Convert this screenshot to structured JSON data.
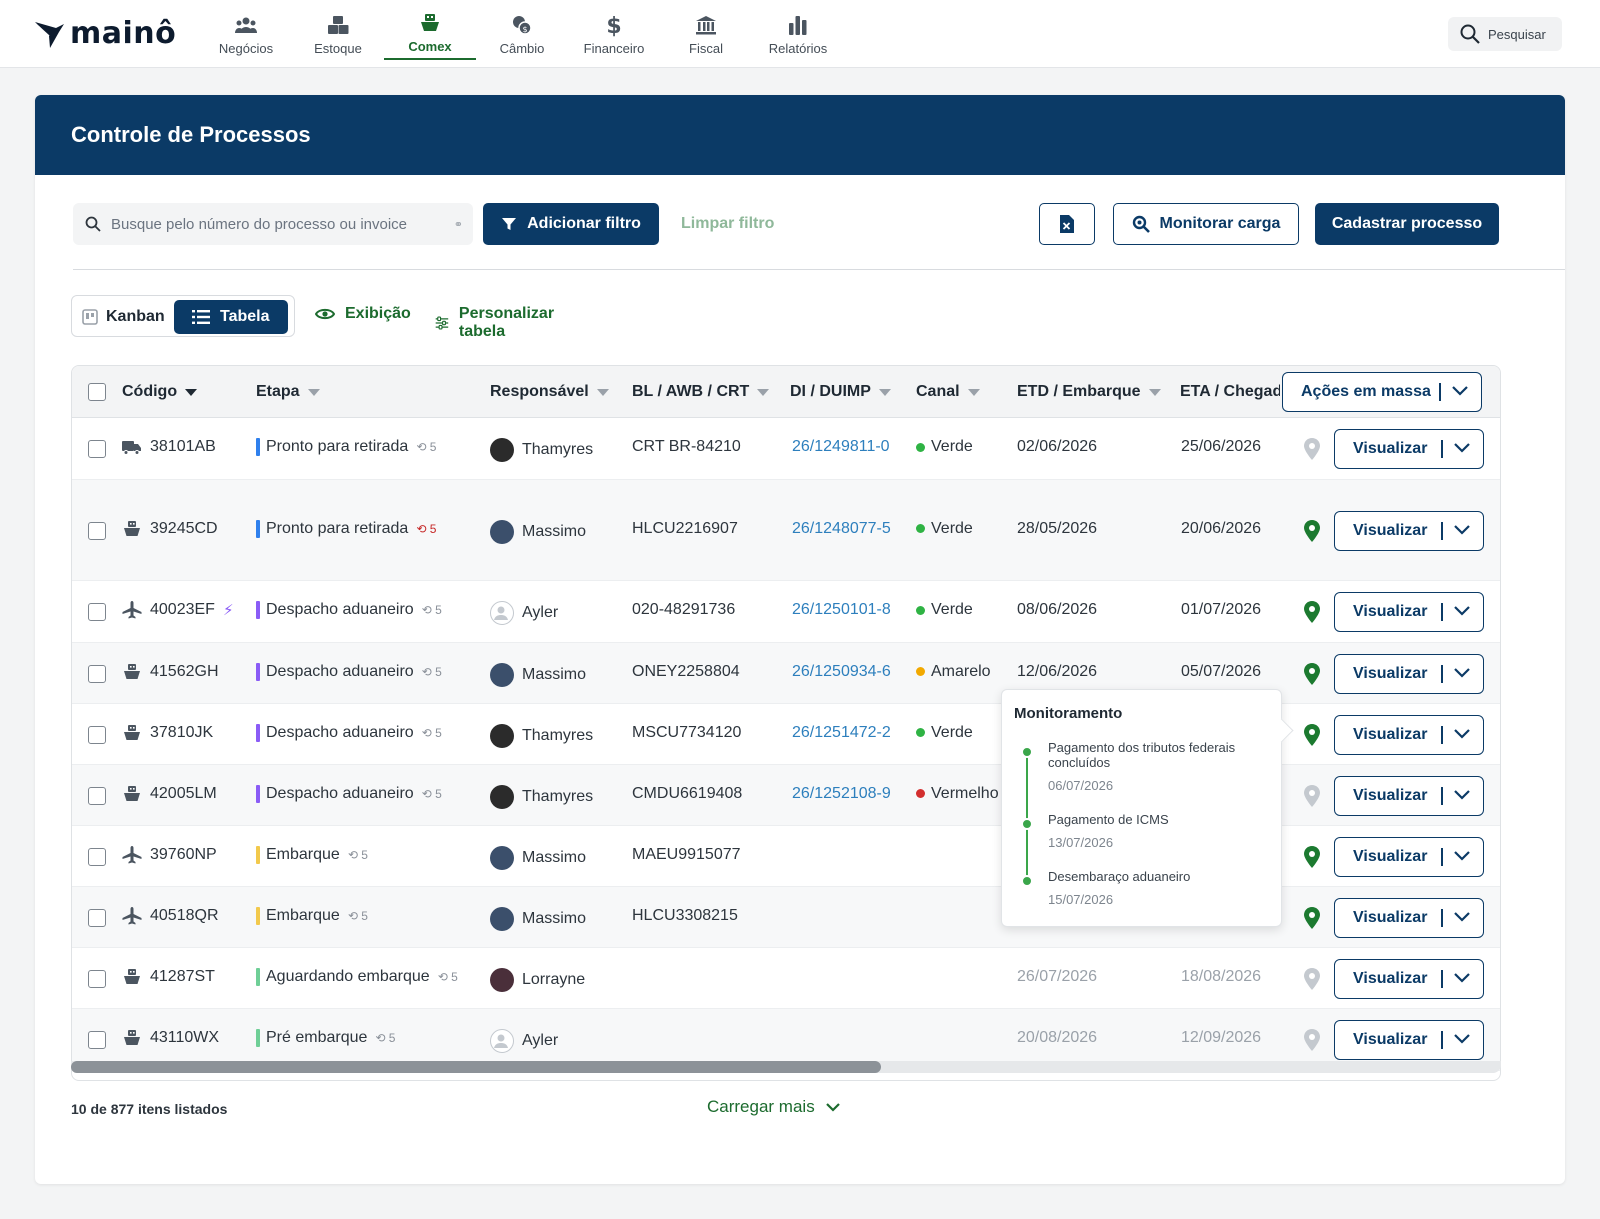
{
  "brand": {
    "name": "mainô"
  },
  "nav": [
    {
      "label": "Negócios",
      "icon": "people-icon",
      "active": false
    },
    {
      "label": "Estoque",
      "icon": "boxes-icon",
      "active": false
    },
    {
      "label": "Comex",
      "icon": "ship-icon",
      "active": true
    },
    {
      "label": "Câmbio",
      "icon": "exchange-icon",
      "active": false
    },
    {
      "label": "Financeiro",
      "icon": "dollar-icon",
      "active": false
    },
    {
      "label": "Fiscal",
      "icon": "bank-icon",
      "active": false
    },
    {
      "label": "Relatórios",
      "icon": "bar-chart-icon",
      "active": false
    }
  ],
  "search": {
    "label": "Pesquisar"
  },
  "page": {
    "title": "Controle de Processos"
  },
  "toolbar": {
    "search_placeholder": "Busque pelo número do processo ou invoice",
    "add_filter": "Adicionar filtro",
    "clear_filter": "Limpar filtro",
    "monitor_cargo": "Monitorar carga",
    "register_process": "Cadastrar processo"
  },
  "view": {
    "kanban": "Kanban",
    "tabela": "Tabela",
    "exibicao": "Exibição",
    "personalizar": "Personalizar tabela"
  },
  "table": {
    "headers": {
      "codigo": "Código",
      "etapa": "Etapa",
      "responsavel": "Responsável",
      "bl": "BL / AWB / CRT",
      "di": "DI / DUIMP",
      "canal": "Canal",
      "etd": "ETD / Embarque",
      "eta": "ETA / Chegada"
    },
    "bulk_actions": "Ações em massa",
    "view_label": "Visualizar",
    "rows": [
      {
        "mode": "truck",
        "code": "38101AB",
        "stage": "Pronto para retirada",
        "stage_color": "#2f80ed",
        "hist": "5",
        "hist_alert": false,
        "person": "Thamyres",
        "avatar": "#2b2b2b",
        "bl": "CRT BR-84210",
        "di": "26/1249811-0",
        "canal": "Verde",
        "canal_color": "#2fb344",
        "etd": "02/06/2026",
        "eta": "25/06/2026",
        "pin": "grey",
        "muted_dates": false,
        "alt": false
      },
      {
        "mode": "ship",
        "code": "39245CD",
        "stage": "Pronto para retirada",
        "stage_color": "#2f80ed",
        "hist": "5",
        "hist_alert": true,
        "person": "Massimo",
        "avatar": "#3b4f6b",
        "bl": "HLCU2216907",
        "di": "26/1248077-5",
        "canal": "Verde",
        "canal_color": "#2fb344",
        "etd": "28/05/2026",
        "eta": "20/06/2026",
        "pin": "green",
        "muted_dates": false,
        "alt": true
      },
      {
        "mode": "plane",
        "code": "40023EF",
        "stage": "Despacho aduaneiro",
        "stage_color": "#8a5cf6",
        "hist": "5",
        "hist_alert": false,
        "person": "Ayler",
        "avatar": "#cfd3d8",
        "bl": "020-48291736",
        "di": "26/1250101-8",
        "canal": "Verde",
        "canal_color": "#2fb344",
        "etd": "08/06/2026",
        "eta": "01/07/2026",
        "pin": "green",
        "muted_dates": false,
        "alt": false,
        "wand": true
      },
      {
        "mode": "ship",
        "code": "41562GH",
        "stage": "Despacho aduaneiro",
        "stage_color": "#8a5cf6",
        "hist": "5",
        "hist_alert": false,
        "person": "Massimo",
        "avatar": "#3b4f6b",
        "bl": "ONEY2258804",
        "di": "26/1250934-6",
        "canal": "Amarelo",
        "canal_color": "#f2a900",
        "etd": "12/06/2026",
        "eta": "05/07/2026",
        "pin": "green",
        "muted_dates": false,
        "alt": true
      },
      {
        "mode": "ship",
        "code": "37810JK",
        "stage": "Despacho aduaneiro",
        "stage_color": "#8a5cf6",
        "hist": "5",
        "hist_alert": false,
        "person": "Thamyres",
        "avatar": "#2b2b2b",
        "bl": "MSCU7734120",
        "di": "26/1251472-2",
        "canal": "Verde",
        "canal_color": "#2fb344",
        "etd": "",
        "eta": "",
        "pin": "green",
        "muted_dates": false,
        "alt": false
      },
      {
        "mode": "ship",
        "code": "42005LM",
        "stage": "Despacho aduaneiro",
        "stage_color": "#8a5cf6",
        "hist": "5",
        "hist_alert": false,
        "person": "Thamyres",
        "avatar": "#2b2b2b",
        "bl": "CMDU6619408",
        "di": "26/1252108-9",
        "canal": "Vermelho",
        "canal_color": "#d32f2f",
        "etd": "",
        "eta": "",
        "pin": "grey",
        "muted_dates": false,
        "alt": true
      },
      {
        "mode": "plane",
        "code": "39760NP",
        "stage": "Embarque",
        "stage_color": "#f2c94c",
        "hist": "5",
        "hist_alert": false,
        "person": "Massimo",
        "avatar": "#3b4f6b",
        "bl": "MAEU9915077",
        "di": "",
        "canal": "",
        "canal_color": "",
        "etd": "",
        "eta": "",
        "pin": "green",
        "muted_dates": false,
        "alt": false
      },
      {
        "mode": "plane",
        "code": "40518QR",
        "stage": "Embarque",
        "stage_color": "#f2c94c",
        "hist": "5",
        "hist_alert": false,
        "person": "Massimo",
        "avatar": "#3b4f6b",
        "bl": "HLCU3308215",
        "di": "",
        "canal": "",
        "canal_color": "",
        "etd": "",
        "eta": "",
        "pin": "green",
        "muted_dates": false,
        "alt": true
      },
      {
        "mode": "ship",
        "code": "41287ST",
        "stage": "Aguardando embarque",
        "stage_color": "#6fcf97",
        "hist": "5",
        "hist_alert": false,
        "person": "Lorrayne",
        "avatar": "#4a2f3a",
        "bl": "",
        "di": "",
        "canal": "",
        "canal_color": "",
        "etd": "26/07/2026",
        "eta": "18/08/2026",
        "pin": "grey",
        "muted_dates": true,
        "alt": false
      },
      {
        "mode": "ship",
        "code": "43110WX",
        "stage": "Pré embarque",
        "stage_color": "#6fcf97",
        "hist": "5",
        "hist_alert": false,
        "person": "Ayler",
        "avatar": "#cfd3d8",
        "bl": "",
        "di": "",
        "canal": "",
        "canal_color": "",
        "etd": "20/08/2026",
        "eta": "12/09/2026",
        "pin": "grey",
        "muted_dates": true,
        "alt": true
      }
    ]
  },
  "tooltip": {
    "title": "Monitoramento",
    "items": [
      {
        "text": "Pagamento dos tributos federais concluídos",
        "date": "06/07/2026"
      },
      {
        "text": "Pagamento de ICMS",
        "date": "13/07/2026"
      },
      {
        "text": "Desembaraço aduaneiro",
        "date": "15/07/2026"
      }
    ]
  },
  "footer": {
    "count": "10 de 877 itens listados",
    "load_more": "Carregar mais"
  },
  "colors": {
    "primary": "#0b3a66",
    "green": "#1c6b2e",
    "link": "#2d7fbd"
  }
}
